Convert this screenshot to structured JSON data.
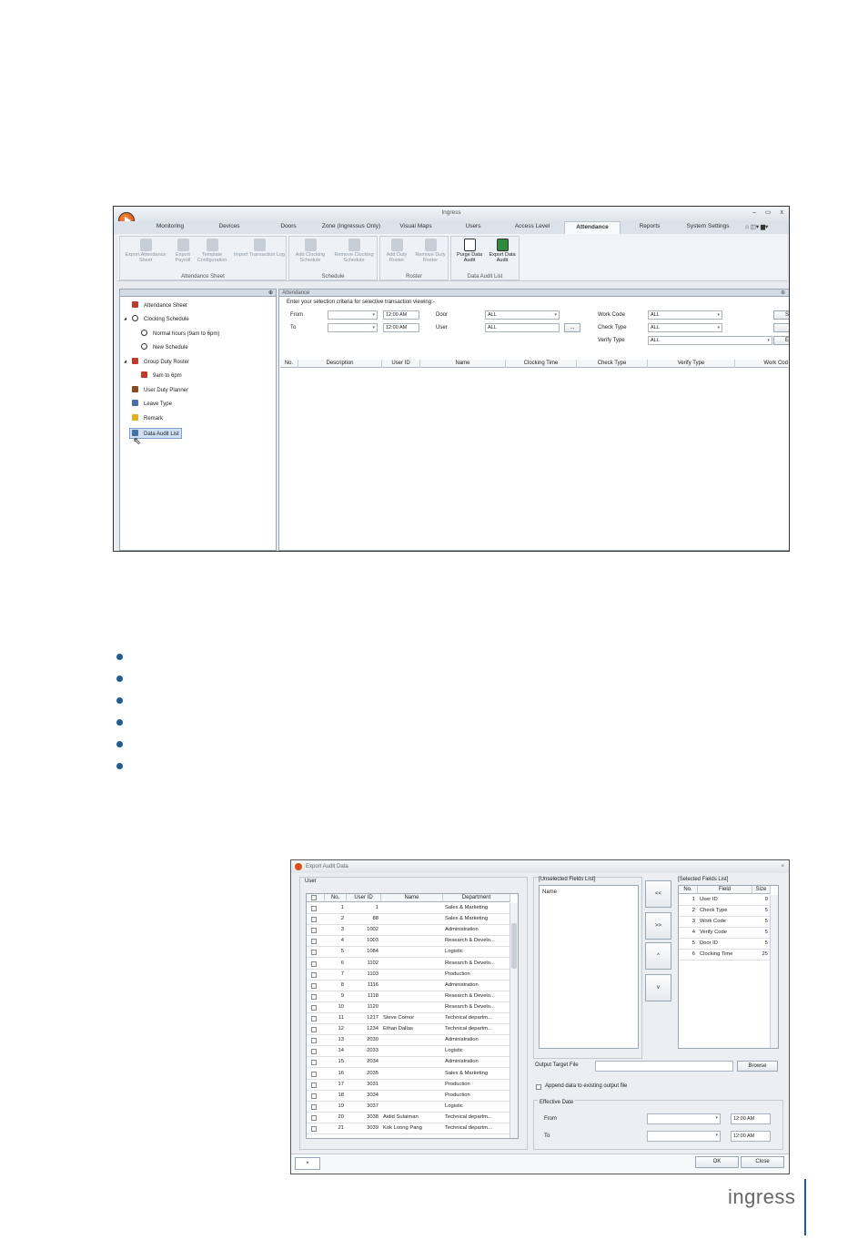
{
  "app": {
    "title": "Ingress",
    "window_controls": "– ▭ x"
  },
  "tabs": [
    "Monitoring",
    "Devices",
    "Doors",
    "Zone (Ingressus Only)",
    "Visual Maps",
    "Users",
    "Access Level",
    "Attendance",
    "Reports",
    "System Settings"
  ],
  "active_tab": "Attendance",
  "tab_extras": "⌂ ◫▾ ▆▾",
  "ribbon": {
    "groups": [
      {
        "label": "Attendance Sheet",
        "buttons": [
          "Export Attendance Sheet",
          "Export Payroll",
          "Template Configuration",
          "Import Transaction Log"
        ]
      },
      {
        "label": "Schedule",
        "buttons": [
          "Add Clocking Schedule",
          "Remove Clocking Schedule"
        ]
      },
      {
        "label": "Roster",
        "buttons": [
          "Add Duty Roster",
          "Remove Duty Roster"
        ]
      },
      {
        "label": "Data Audit List",
        "buttons": [
          "Purge Data Audit",
          "Export Data Audit"
        ]
      }
    ]
  },
  "left_panel": {
    "pin": "⊕",
    "items": [
      {
        "label": "Attendance Sheet",
        "icon": "sheet-icon",
        "color": "#c0392b",
        "level": 0
      },
      {
        "label": "Clocking Schedule",
        "icon": "clock-icon",
        "color": "#333333",
        "level": 0,
        "expander": "◢"
      },
      {
        "label": "Normal hours (9am to 6pm)",
        "icon": "clock-icon",
        "color": "#333333",
        "level": 1
      },
      {
        "label": "New Schedule",
        "icon": "clock-icon",
        "color": "#333333",
        "level": 1
      },
      {
        "label": "Group Duty Roster",
        "icon": "calendar-icon",
        "color": "#c0392b",
        "level": 0,
        "expander": "◢"
      },
      {
        "label": "9am to 6pm",
        "icon": "calendar-icon",
        "color": "#c0392b",
        "level": 1
      },
      {
        "label": "User Duty Planner",
        "icon": "briefcase-icon",
        "color": "#8e4a1f",
        "level": 0
      },
      {
        "label": "Leave Type",
        "icon": "list-icon",
        "color": "#4a6fa5",
        "level": 0
      },
      {
        "label": "Remark",
        "icon": "note-icon",
        "color": "#e0b020",
        "level": 0
      },
      {
        "label": "Data Audit List",
        "icon": "audit-icon",
        "color": "#4a6fa5",
        "level": 0,
        "selected": true
      }
    ]
  },
  "attendance": {
    "header": "Attendance",
    "pin": "⊕",
    "criteria_label": "Enter your selection criteria for selective transaction viewing:-",
    "from_label": "From",
    "to_label": "To",
    "from_time": "12:00 AM",
    "to_time": "12:00 AM",
    "door_label": "Door",
    "door_value": "ALL",
    "user_label": "User",
    "user_value": "ALL",
    "browse_btn": "...",
    "work_code_label": "Work Code",
    "work_code_value": "ALL",
    "check_type_label": "Check Type",
    "check_type_value": "ALL",
    "verify_type_label": "Verify Type",
    "verify_type_value": "ALL",
    "side_btn_1": "S",
    "side_btn_3": "E",
    "columns": [
      "No.",
      "Description",
      "User ID",
      "Name",
      "Clocking Time",
      "Check Type",
      "Verify Type",
      "Work Cod"
    ]
  },
  "dialog": {
    "title": "Export Audit Data",
    "close": "×",
    "user_group": "User",
    "user_columns": [
      "No.",
      "User ID",
      "Name",
      "Department"
    ],
    "users": [
      {
        "no": "1",
        "id": "1",
        "name": "",
        "dept": "Sales & Marketing"
      },
      {
        "no": "2",
        "id": "88",
        "name": "",
        "dept": "Sales & Marketing"
      },
      {
        "no": "3",
        "id": "1002",
        "name": "",
        "dept": "Administration"
      },
      {
        "no": "4",
        "id": "1003",
        "name": "",
        "dept": "Research & Develo..."
      },
      {
        "no": "5",
        "id": "1084",
        "name": "",
        "dept": "Logistic"
      },
      {
        "no": "6",
        "id": "1102",
        "name": "",
        "dept": "Research & Develo..."
      },
      {
        "no": "7",
        "id": "1103",
        "name": "",
        "dept": "Production"
      },
      {
        "no": "8",
        "id": "1116",
        "name": "",
        "dept": "Administration"
      },
      {
        "no": "9",
        "id": "1118",
        "name": "",
        "dept": "Research & Develo..."
      },
      {
        "no": "10",
        "id": "1120",
        "name": "",
        "dept": "Research & Develo..."
      },
      {
        "no": "11",
        "id": "1217",
        "name": "Steve Cornor",
        "dept": "Technical departm..."
      },
      {
        "no": "12",
        "id": "1234",
        "name": "Ethan Dallas",
        "dept": "Technical departm..."
      },
      {
        "no": "13",
        "id": "2030",
        "name": "",
        "dept": "Administration"
      },
      {
        "no": "14",
        "id": "2033",
        "name": "",
        "dept": "Logistic"
      },
      {
        "no": "15",
        "id": "2034",
        "name": "",
        "dept": "Administration"
      },
      {
        "no": "16",
        "id": "2035",
        "name": "",
        "dept": "Sales & Marketing"
      },
      {
        "no": "17",
        "id": "3031",
        "name": "",
        "dept": "Production"
      },
      {
        "no": "18",
        "id": "3034",
        "name": "",
        "dept": "Production"
      },
      {
        "no": "19",
        "id": "3037",
        "name": "",
        "dept": "Logistic"
      },
      {
        "no": "20",
        "id": "3038",
        "name": "Aidid Sulaiman",
        "dept": "Technical departm..."
      },
      {
        "no": "21",
        "id": "3039",
        "name": "Kok Loong Pang",
        "dept": "Technical departm..."
      }
    ],
    "unselected_label": "[Unselected Fields List]",
    "unselected_header": "Name",
    "move_all_left": "<<",
    "move_all_right": ">>",
    "move_up": "^",
    "move_down": "v",
    "selected_label": "[Selected Fields List]",
    "selected_columns": [
      "No.",
      "Field",
      "Size"
    ],
    "selected_fields": [
      {
        "no": "1",
        "field": "User ID",
        "size": "9"
      },
      {
        "no": "2",
        "field": "Check Type",
        "size": "5"
      },
      {
        "no": "3",
        "field": "Work Code",
        "size": "5"
      },
      {
        "no": "4",
        "field": "Verify Code",
        "size": "5"
      },
      {
        "no": "5",
        "field": "Door ID",
        "size": "5"
      },
      {
        "no": "6",
        "field": "Clocking Time",
        "size": "25"
      }
    ],
    "output_label": "Output Target File",
    "output_value": "",
    "browse": "Browse",
    "append_label": "Append data to existing output file",
    "effective_label": "Effective Date",
    "from_label": "From",
    "to_label": "To",
    "from_time": "12:00 AM",
    "to_time": "12:00 AM",
    "ok": "OK",
    "close_btn": "Close",
    "footer_tab": "×"
  },
  "logo": "ingress"
}
